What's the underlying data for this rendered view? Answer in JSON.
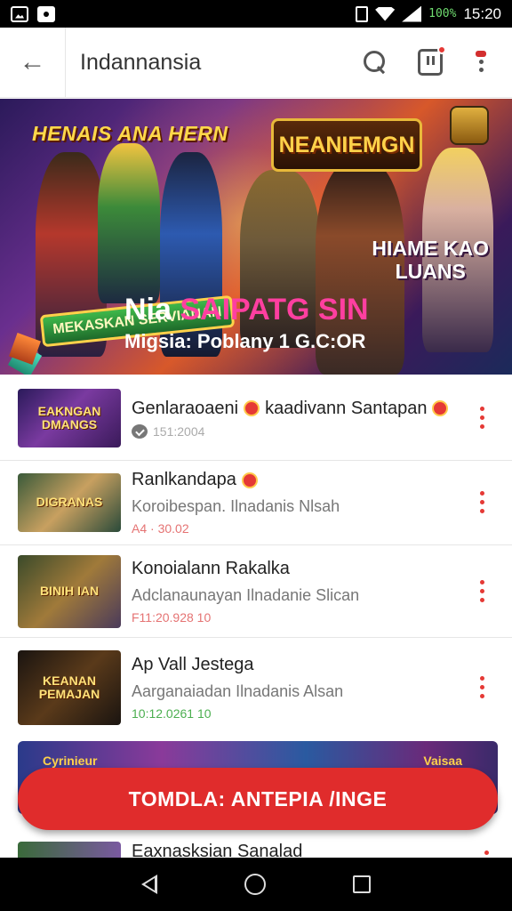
{
  "status_bar": {
    "battery": "100%",
    "time": "15:20"
  },
  "app_bar": {
    "title": "Indannansia",
    "icons": [
      "arrow-back-icon",
      "search-icon",
      "notification-icon",
      "more-icon"
    ]
  },
  "banner": {
    "left_title": "HENAIS ANA HERN",
    "logo_text": "NEANIEMGN",
    "green_badge": "MEKASKAN SERVIANAN",
    "right_title_line1": "HIAME KAO",
    "right_title_line2": "LUANS",
    "headline_prefix": "Nia",
    "headline_highlight": "SAIPATG SIN",
    "subtitle": "Migsia: Poblany 1 G.C:OR"
  },
  "items": [
    {
      "thumb_text": "EAKNGAN DMANGS",
      "title": "Genlaraoaeni",
      "title_suffix": "kaadivann Santapan",
      "subtitle": "",
      "meta": "151:2004",
      "meta_style": "comment"
    },
    {
      "thumb_text": "DIGRANAS",
      "title": "Ranlkandapa",
      "title_suffix": "",
      "subtitle": "Koroibespan. Ilnadanis Nlsah",
      "meta": "A4 · 30.02",
      "meta_style": "red"
    },
    {
      "thumb_text": "BINIH IAN",
      "title": "Konoialann Rakalka",
      "title_suffix": "",
      "subtitle": "Adclanaunayan Ilnadanie Slican",
      "meta": "F11:20.928 10",
      "meta_style": "red"
    },
    {
      "thumb_text": "KEANAN PEMAJAN",
      "title": "Ap Vall Jestega",
      "title_suffix": "",
      "subtitle": "Aarganaiadan Ilnadanis Alsan",
      "meta": "10:12.0261 10",
      "meta_style": "green"
    }
  ],
  "promo": {
    "left_label": "Cyrinieur",
    "right_label": "Vaisaa",
    "cta_label": "TOMDLA: ANTEPIA /INGE"
  },
  "partial_item": {
    "title": "Eaxnasksian Sanalad"
  },
  "colors": {
    "accent": "#e53935",
    "cta": "#e02c2c",
    "status_bar": "#000000"
  }
}
